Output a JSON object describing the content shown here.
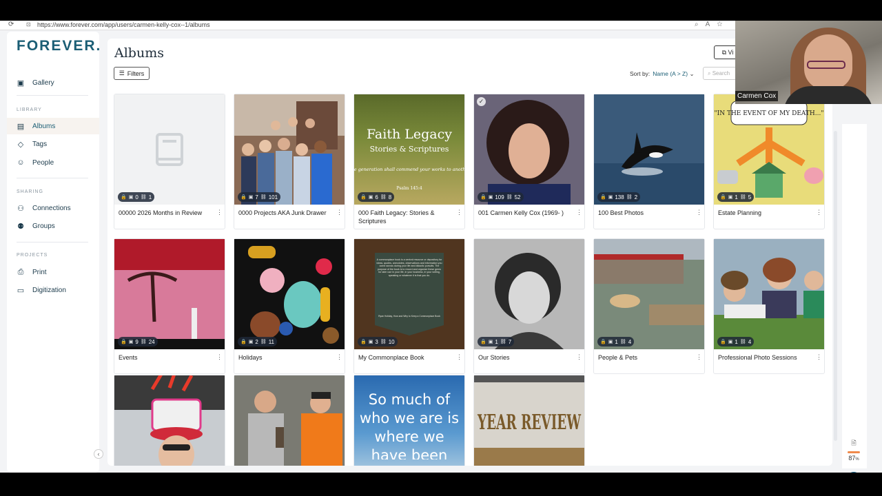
{
  "browser": {
    "url": "https://www.forever.com/app/users/carmen-kelly-cox--1/albums"
  },
  "sidebar": {
    "logo": "FOREVER.",
    "gallery": "Gallery",
    "library_heading": "LIBRARY",
    "albums": "Albums",
    "tags": "Tags",
    "people": "People",
    "sharing_heading": "SHARING",
    "connections": "Connections",
    "groups": "Groups",
    "projects_heading": "PROJECTS",
    "print": "Print",
    "digitization": "Digitization"
  },
  "header": {
    "title": "Albums",
    "filters_label": "Filters",
    "sort_label": "Sort by:",
    "sort_value": "Name (A > Z)",
    "search_placeholder": "Search",
    "view_label": "Vi"
  },
  "albums": [
    {
      "title": "00000 2026 Months in Review",
      "photos": "0",
      "items": "1"
    },
    {
      "title": "0000 Projects AKA Junk Drawer",
      "photos": "7",
      "items": "101"
    },
    {
      "title": "000 Faith Legacy: Stories & Scriptures",
      "photos": "6",
      "items": "8"
    },
    {
      "title": "001 Carmen Kelly Cox (1969- )",
      "photos": "109",
      "items": "52"
    },
    {
      "title": "100 Best Photos",
      "photos": "138",
      "items": "2"
    },
    {
      "title": "Estate Planning",
      "photos": "1",
      "items": "5"
    },
    {
      "title": "Events",
      "photos": "9",
      "items": "24"
    },
    {
      "title": "Holidays",
      "photos": "2",
      "items": "11"
    },
    {
      "title": "My Commonplace Book",
      "photos": "3",
      "items": "10"
    },
    {
      "title": "Our Stories",
      "photos": "1",
      "items": "7"
    },
    {
      "title": "People & Pets",
      "photos": "1",
      "items": "4"
    },
    {
      "title": "Professional Photo Sessions",
      "photos": "1",
      "items": "4"
    }
  ],
  "thumb_text": {
    "faith_title": "Faith Legacy",
    "faith_sub": "Stories & Scriptures",
    "faith_quote": "One generation shall commend your works to another.",
    "faith_ref": "Psalm 145:4",
    "estate_text": "\"IN THE EVENT OF MY DEATH...\"",
    "commonplace_text": "A commonplace book is a central resource or depository for ideas, quotes, anecdotes, observations and information you come across during your life and didactic pursuits. The purpose of the book is to record and organize these gems for later use in your life, in your business, in your writing, speaking or whatever it is that you do.",
    "commonplace_attr": "Ryan Holiday, How and Why to Keep a Commonplace Book",
    "quote_card": "So much of who we are is where we have been",
    "year_review": "YEAR REVIEW"
  },
  "storage": {
    "percent": "87",
    "unit": "%"
  },
  "help_label": "?",
  "webcam": {
    "name": "Carmen Cox"
  },
  "colors": {
    "brand": "#1b5e75",
    "accent": "#f08a4b",
    "help": "#1b6e93"
  }
}
